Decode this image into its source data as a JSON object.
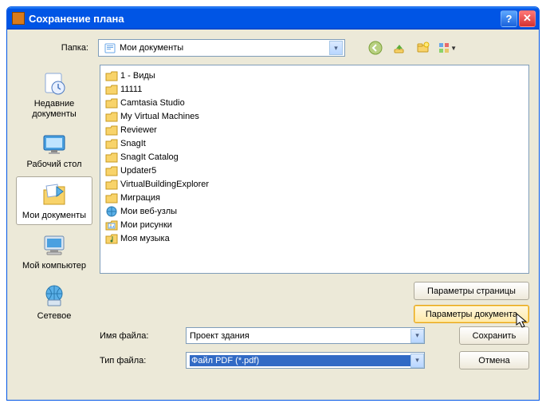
{
  "titlebar": {
    "title": "Сохранение плана"
  },
  "folder_row": {
    "label": "Папка:",
    "current": "Мои документы"
  },
  "places": [
    {
      "id": "recent",
      "label": "Недавние документы",
      "icon": "recent",
      "selected": false
    },
    {
      "id": "desktop",
      "label": "Рабочий стол",
      "icon": "desktop",
      "selected": false
    },
    {
      "id": "mydocs",
      "label": "Мои документы",
      "icon": "mydocs",
      "selected": true
    },
    {
      "id": "computer",
      "label": "Мой компьютер",
      "icon": "computer",
      "selected": false
    },
    {
      "id": "network",
      "label": "Сетевое",
      "icon": "network",
      "selected": false
    }
  ],
  "files": [
    {
      "name": "1 - Виды",
      "kind": "folder"
    },
    {
      "name": "11111",
      "kind": "folder"
    },
    {
      "name": "Camtasia Studio",
      "kind": "folder"
    },
    {
      "name": "My Virtual Machines",
      "kind": "folder"
    },
    {
      "name": "Reviewer",
      "kind": "folder"
    },
    {
      "name": "SnagIt",
      "kind": "folder"
    },
    {
      "name": "SnagIt Catalog",
      "kind": "folder"
    },
    {
      "name": "Updater5",
      "kind": "folder"
    },
    {
      "name": "VirtualBuildingExplorer",
      "kind": "folder"
    },
    {
      "name": "Миграция",
      "kind": "folder"
    },
    {
      "name": "Мои веб-узлы",
      "kind": "web"
    },
    {
      "name": "Мои рисунки",
      "kind": "pics"
    },
    {
      "name": "Моя музыка",
      "kind": "music"
    }
  ],
  "buttons": {
    "page_setup": "Параметры страницы",
    "doc_options": "Параметры документа",
    "save": "Сохранить",
    "cancel": "Отмена"
  },
  "filename": {
    "label": "Имя файла:",
    "value": "Проект здания"
  },
  "filetype": {
    "label": "Тип файла:",
    "value": "Файл PDF (*.pdf)"
  },
  "toolbar_icons": [
    "back",
    "up",
    "newfolder",
    "views"
  ]
}
